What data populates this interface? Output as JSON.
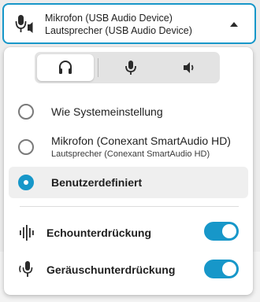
{
  "device_select": {
    "line1": "Mikrofon (USB Audio Device)",
    "line2": "Lautsprecher (USB Audio Device)",
    "icon": "microphone-speaker-icon",
    "chevron": "chevron-up-icon"
  },
  "segmented": {
    "active": "headset",
    "items": [
      {
        "icon": "headset-icon"
      },
      {
        "icon": "microphone-icon"
      },
      {
        "icon": "speaker-icon"
      }
    ]
  },
  "options": [
    {
      "label": "Wie Systemeinstellung",
      "selected": false
    },
    {
      "label": "Mikrofon (Conexant SmartAudio HD)",
      "sub": "Lautsprecher (Conexant SmartAudio HD)",
      "selected": false
    },
    {
      "label": "Benutzerdefiniert",
      "selected": true
    }
  ],
  "features": [
    {
      "label": "Echounterdrückung",
      "icon": "echo-waveform-icon",
      "enabled": true
    },
    {
      "label": "Geräuschunterdrückung",
      "icon": "noise-suppression-mic-icon",
      "enabled": true
    }
  ],
  "colors": {
    "accent": "#1797c9",
    "selected_row": "#efefef",
    "segment_bg": "#e3e3e3"
  }
}
